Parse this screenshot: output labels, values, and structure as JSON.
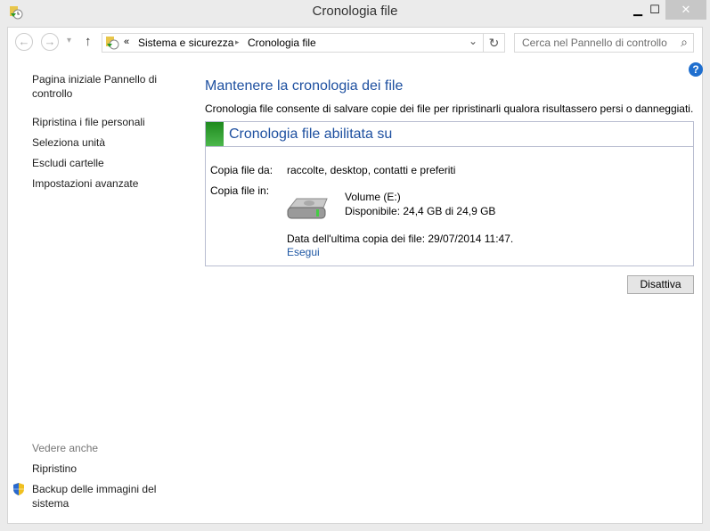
{
  "window": {
    "title": "Cronologia file",
    "minimize": "▁",
    "maximize": "☐",
    "close": "✕"
  },
  "toolbar": {
    "back": "←",
    "forward": "→",
    "dropdown": "▾",
    "up": "↑",
    "breadcrumb_prefix": "«",
    "breadcrumb": [
      "Sistema e sicurezza",
      "Cronologia file"
    ],
    "separator": "▸",
    "address_dropdown": "⌄",
    "refresh": "↻",
    "search_placeholder": "Cerca nel Pannello di controllo",
    "search_icon": "⌕",
    "help": "?"
  },
  "sidebar": {
    "items": [
      "Pagina iniziale Pannello di controllo",
      "Ripristina i file personali",
      "Seleziona unità",
      "Escludi cartelle",
      "Impostazioni avanzate"
    ],
    "see_also": "Vedere anche",
    "see_also_items": [
      "Ripristino",
      "Backup delle immagini del sistema"
    ]
  },
  "main": {
    "heading": "Mantenere la cronologia dei file",
    "description": "Cronologia file consente di salvare copie dei file per ripristinarli qualora risultassero persi o danneggiati.",
    "status_title": "Cronologia file abilitata su",
    "status_color": "#3a9a2a",
    "copy_from_label": "Copia file da:",
    "copy_from_value": "raccolte, desktop, contatti e preferiti",
    "copy_to_label": "Copia file in:",
    "drive_name": "Volume (E:)",
    "drive_space": "Disponibile: 24,4 GB di 24,9 GB",
    "last_copy": "Data dell'ultima copia dei file: 29/07/2014 11:47.",
    "run_link": "Esegui",
    "disable_button": "Disattiva"
  }
}
